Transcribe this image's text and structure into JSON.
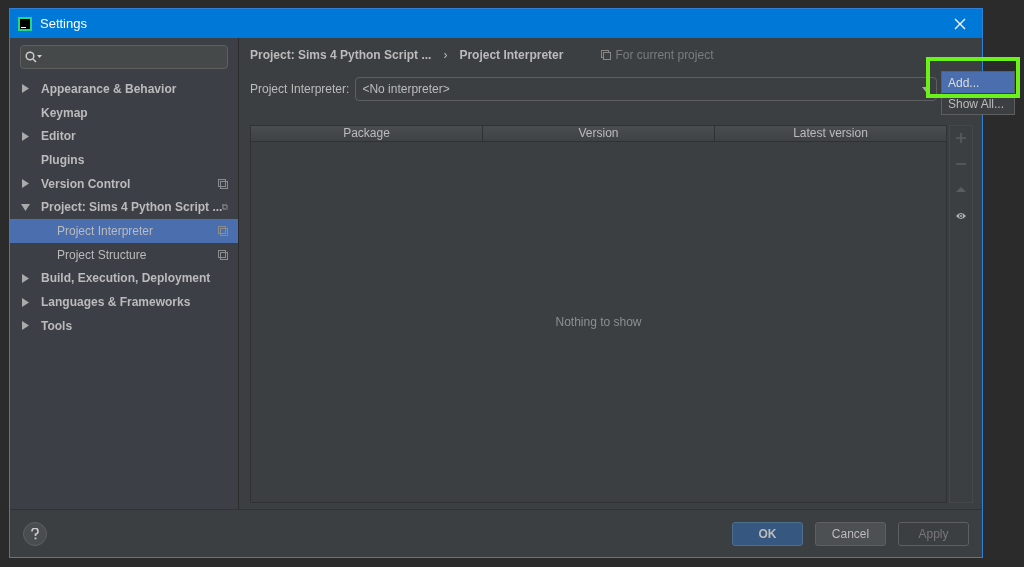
{
  "window": {
    "title": "Settings"
  },
  "sidebar": {
    "items": [
      {
        "label": "Appearance & Behavior",
        "expandable": true,
        "expanded": false,
        "selected": false,
        "project_scoped": false
      },
      {
        "label": "Keymap",
        "expandable": false,
        "selected": false,
        "project_scoped": false
      },
      {
        "label": "Editor",
        "expandable": true,
        "expanded": false,
        "selected": false,
        "project_scoped": false
      },
      {
        "label": "Plugins",
        "expandable": false,
        "selected": false,
        "project_scoped": false
      },
      {
        "label": "Version Control",
        "expandable": true,
        "expanded": false,
        "selected": false,
        "project_scoped": true
      },
      {
        "label": "Project: Sims 4 Python Script ...",
        "expandable": true,
        "expanded": true,
        "selected": false,
        "project_scoped": true,
        "children": [
          {
            "label": "Project Interpreter",
            "selected": true,
            "project_scoped": true
          },
          {
            "label": "Project Structure",
            "selected": false,
            "project_scoped": true
          }
        ]
      },
      {
        "label": "Build, Execution, Deployment",
        "expandable": true,
        "expanded": false,
        "selected": false,
        "project_scoped": false
      },
      {
        "label": "Languages & Frameworks",
        "expandable": true,
        "expanded": false,
        "selected": false,
        "project_scoped": false
      },
      {
        "label": "Tools",
        "expandable": true,
        "expanded": false,
        "selected": false,
        "project_scoped": false
      }
    ]
  },
  "breadcrumb": [
    "Project: Sims 4 Python Script ...",
    "›",
    "Project Interpreter"
  ],
  "scope_note": "For current project",
  "interpreter": {
    "label": "Project Interpreter:",
    "value": "<No interpreter>"
  },
  "menu": [
    {
      "label": "Add...",
      "selected": true
    },
    {
      "label": "Show All...",
      "selected": false
    }
  ],
  "table": {
    "columns": [
      "Package",
      "Version",
      "Latest version"
    ],
    "empty_text": "Nothing to show"
  },
  "table_tools": [
    {
      "kind": "plus",
      "disabled": true
    },
    {
      "kind": "minus",
      "disabled": true
    },
    {
      "kind": "up",
      "disabled": true
    },
    {
      "kind": "eye",
      "disabled": false
    }
  ],
  "buttons": [
    {
      "label": "OK",
      "kind": "default",
      "disabled": false
    },
    {
      "label": "Cancel",
      "kind": "normal",
      "disabled": false
    },
    {
      "label": "Apply",
      "kind": "normal",
      "disabled": true
    }
  ]
}
